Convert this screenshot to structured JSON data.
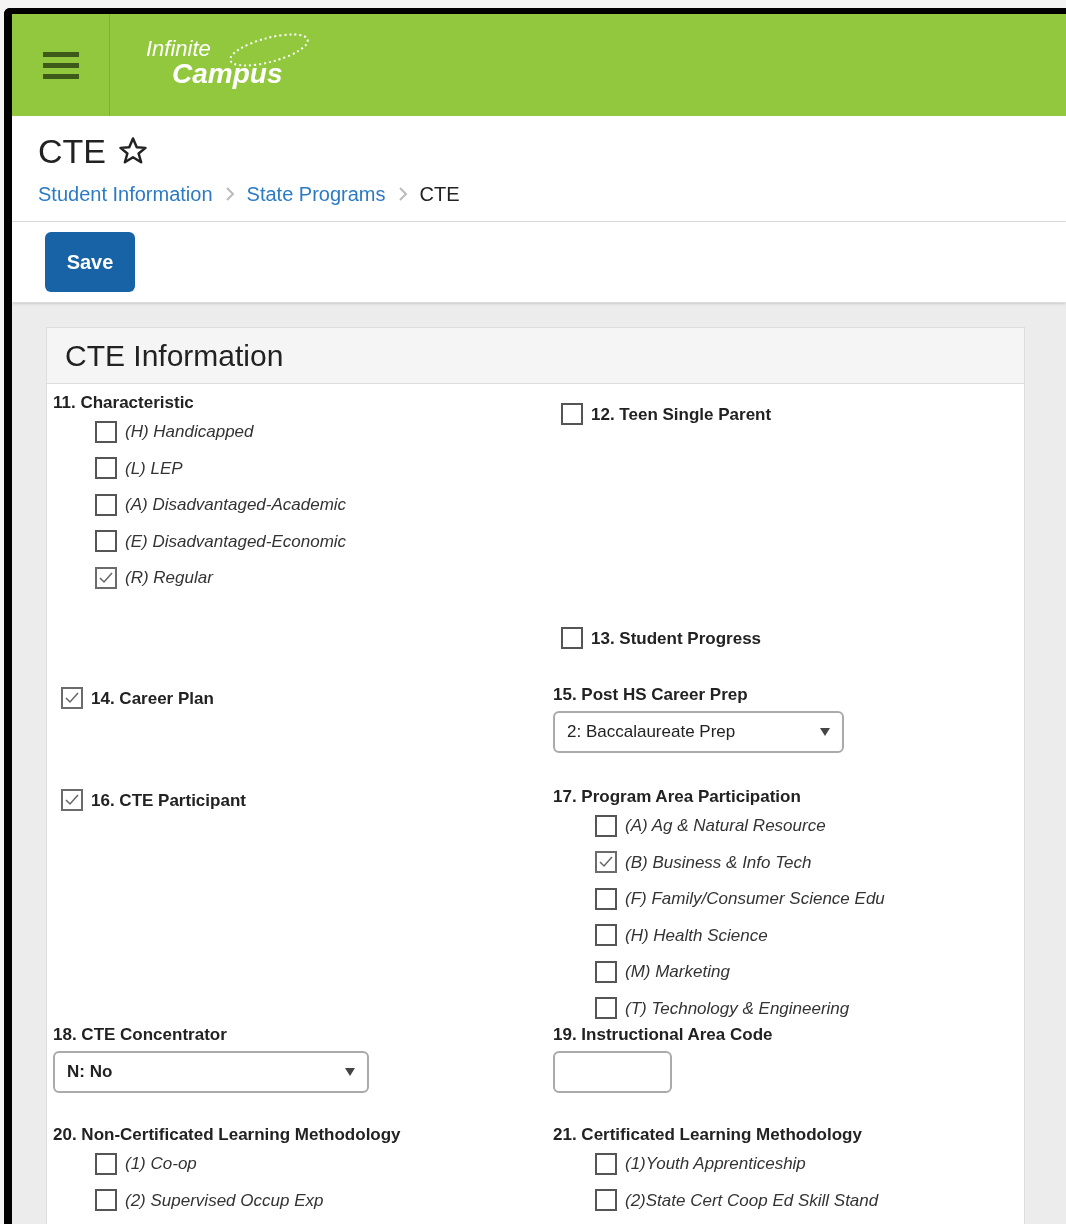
{
  "header": {
    "logo": {
      "line1": "Infinite",
      "line2": "Campus"
    }
  },
  "page": {
    "title": "CTE",
    "favorite": false,
    "breadcrumbs": [
      {
        "label": "Student Information",
        "kind": "link"
      },
      {
        "label": "State Programs",
        "kind": "link"
      },
      {
        "label": "CTE",
        "kind": "current"
      }
    ]
  },
  "toolbar": {
    "buttons": [
      "Save"
    ]
  },
  "panel": {
    "title": "CTE Information",
    "rows": [
      {
        "left": {
          "kind": "checkbox_group",
          "label": "11. Characteristic",
          "options": [
            {
              "label": "(H) Handicapped",
              "checked": false
            },
            {
              "label": "(L) LEP",
              "checked": false
            },
            {
              "label": "(A) Disadvantaged-Academic",
              "checked": false
            },
            {
              "label": "(E) Disadvantaged-Economic",
              "checked": false
            },
            {
              "label": "(R) Regular",
              "checked": true
            }
          ]
        },
        "right": {
          "kind": "checkbox",
          "label": "12. Teen Single Parent",
          "checked": false
        }
      },
      {
        "right": {
          "kind": "checkbox",
          "label": "13. Student Progress",
          "checked": false
        }
      },
      {
        "left": {
          "kind": "checkbox",
          "label": "14. Career Plan",
          "checked": true
        },
        "right": {
          "kind": "select",
          "label": "15. Post HS Career Prep",
          "value": "2: Baccalaureate Prep"
        }
      },
      {
        "left": {
          "kind": "checkbox",
          "label": "16. CTE Participant",
          "checked": true
        },
        "right": {
          "kind": "checkbox_group",
          "label": "17. Program Area Participation",
          "options": [
            {
              "label": "(A) Ag & Natural Resource",
              "checked": false
            },
            {
              "label": "(B) Business & Info Tech",
              "checked": true
            },
            {
              "label": "(F) Family/Consumer Science Edu",
              "checked": false
            },
            {
              "label": "(H) Health Science",
              "checked": false
            },
            {
              "label": "(M) Marketing",
              "checked": false
            },
            {
              "label": "(T) Technology & Engineering",
              "checked": false
            }
          ]
        }
      },
      {
        "left": {
          "kind": "select",
          "label": "18. CTE Concentrator",
          "value": "N: No"
        },
        "right": {
          "kind": "text_input",
          "label": "19. Instructional Area Code"
        }
      },
      {
        "left": {
          "kind": "checkbox_group",
          "label": "20. Non-Certificated Learning Methodology",
          "options": [
            {
              "label": "(1) Co-op",
              "checked": false
            },
            {
              "label": "(2) Supervised Occup Exp",
              "checked": false
            }
          ]
        },
        "right": {
          "kind": "checkbox_group",
          "label": "21. Certificated Learning Methodology",
          "options": [
            {
              "label": "(1)Youth Apprenticeship",
              "checked": false
            },
            {
              "label": "(2)State Cert Coop Ed Skill Stand",
              "checked": false
            }
          ]
        }
      }
    ]
  }
}
